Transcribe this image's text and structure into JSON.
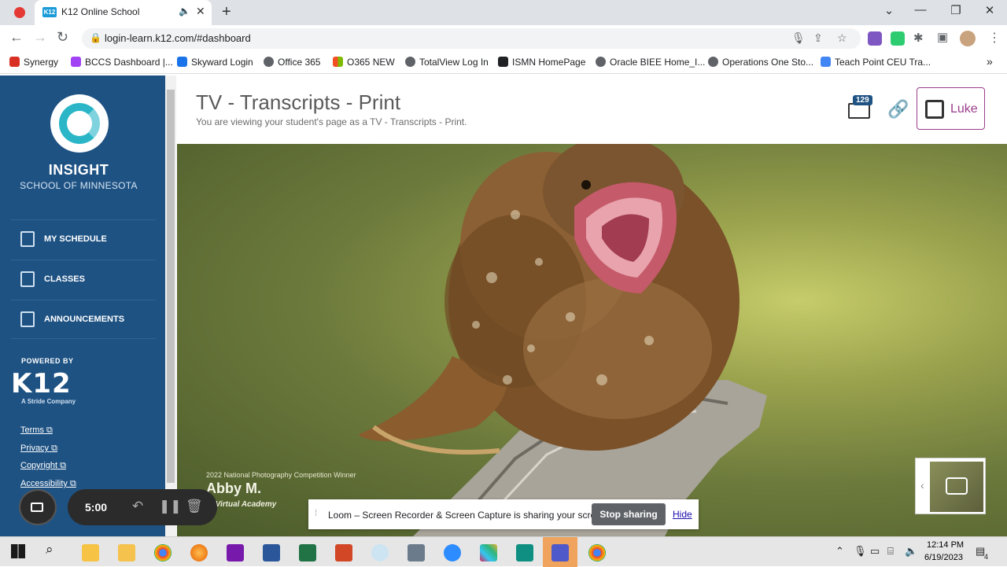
{
  "browser": {
    "tab_title": "K12 Online School",
    "tab_favicon": "K12",
    "url": "login-learn.k12.com/#dashboard",
    "bookmarks": [
      {
        "label": "Synergy",
        "color": "#d93025"
      },
      {
        "label": "BCCS Dashboard |...",
        "color": "#a142f4"
      },
      {
        "label": "Skyward Login",
        "color": "#1a73e8"
      },
      {
        "label": "Office 365",
        "color": "#5f6368"
      },
      {
        "label": "O365 NEW",
        "color": "#f4b400"
      },
      {
        "label": "TotalView Log In",
        "color": "#5f6368"
      },
      {
        "label": "ISMN HomePage",
        "color": "#202124"
      },
      {
        "label": "Oracle BIEE Home_I...",
        "color": "#5f6368"
      },
      {
        "label": "Operations One Sto...",
        "color": "#5f6368"
      },
      {
        "label": "Teach Point CEU Tra...",
        "color": "#4285f4"
      }
    ],
    "more_bookmarks": "»"
  },
  "sidebar": {
    "school_name": "INSIGHT",
    "school_sub": "SCHOOL OF MINNESOTA",
    "nav": [
      {
        "label": "MY SCHEDULE",
        "icon": "calendar-icon"
      },
      {
        "label": "CLASSES",
        "icon": "book-icon"
      },
      {
        "label": "ANNOUNCEMENTS",
        "icon": "megaphone-icon"
      }
    ],
    "powered_by": "POWERED BY",
    "k12_logo": "K12",
    "k12_sub": "A Stride Company",
    "footer_links": [
      "Terms",
      "Privacy",
      "Copyright",
      "Accessibility"
    ]
  },
  "header": {
    "title": "TV - Transcripts - Print",
    "subtitle": "You are viewing your student's page as a TV - Transcripts - Print.",
    "mail_count": "129",
    "user_name": "Luke"
  },
  "hero": {
    "credit_small": "2022 National Photography Competition Winner",
    "credit_name": "Abby M.",
    "credit_school": "io Virtual Academy"
  },
  "loom": {
    "text": "Loom – Screen Recorder & Screen Capture is sharing your screen.",
    "stop_label": "Stop sharing",
    "hide_label": "Hide"
  },
  "recorder": {
    "time": "5:00"
  },
  "taskbar": {
    "time": "12:14 PM",
    "date": "6/19/2023",
    "notification_count": "4"
  }
}
